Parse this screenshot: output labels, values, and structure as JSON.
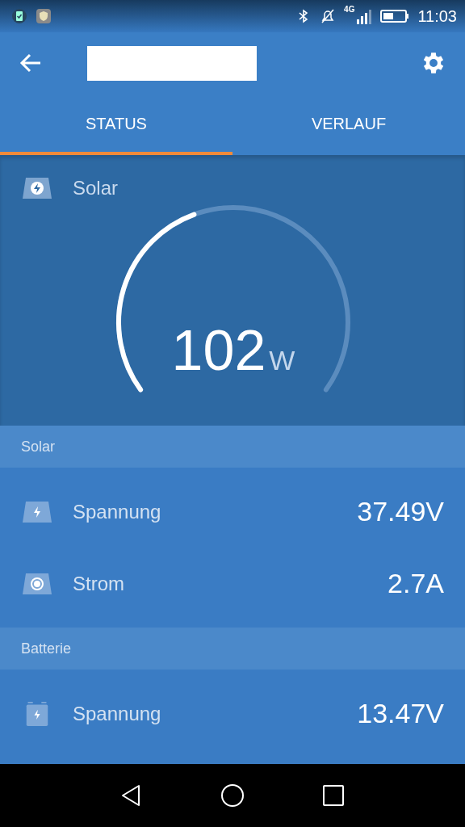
{
  "status_bar": {
    "network": "4G",
    "time": "11:03"
  },
  "tabs": [
    {
      "label": "STATUS",
      "selected": true
    },
    {
      "label": "VERLAUF",
      "selected": false
    }
  ],
  "gauge": {
    "label": "Solar",
    "value": "102",
    "unit": "W"
  },
  "sections": [
    {
      "title": "Solar",
      "rows": [
        {
          "kind": "panel-voltage",
          "label": "Spannung",
          "value": "37.49V"
        },
        {
          "kind": "panel-current",
          "label": "Strom",
          "value": "2.7A"
        }
      ]
    },
    {
      "title": "Batterie",
      "rows": [
        {
          "kind": "battery-voltage",
          "label": "Spannung",
          "value": "13.47V"
        }
      ]
    }
  ]
}
